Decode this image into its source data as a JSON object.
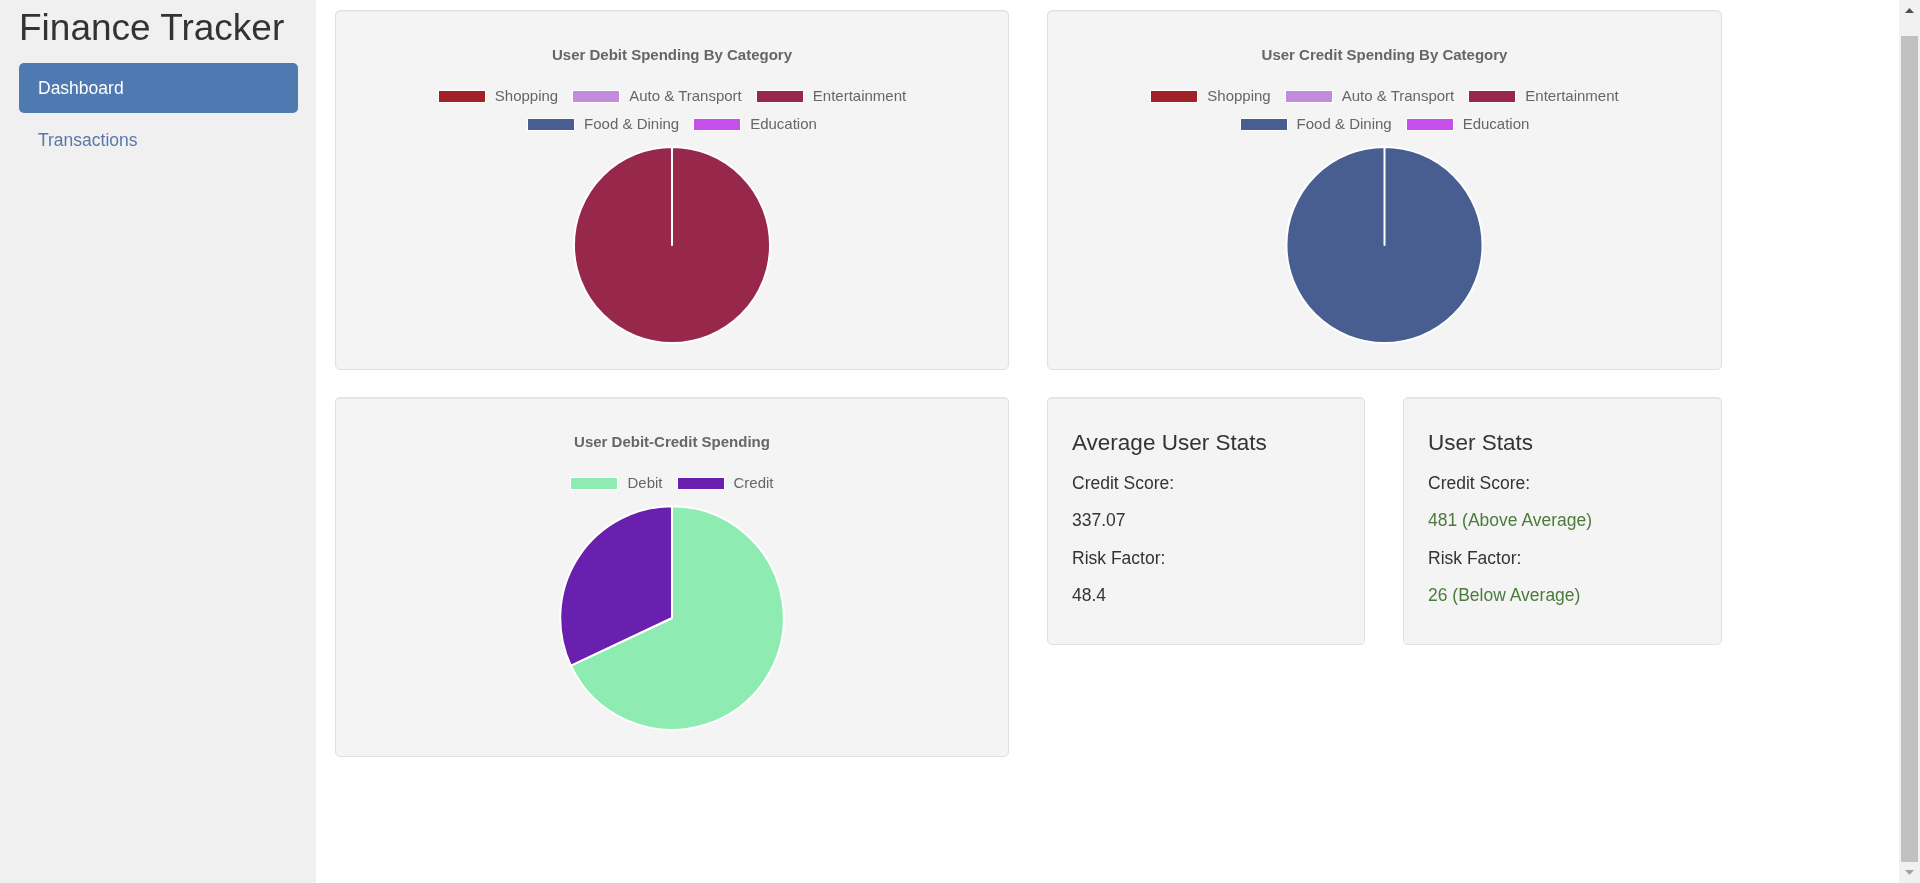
{
  "sidebar": {
    "title": "Finance Tracker",
    "items": [
      {
        "label": "Dashboard",
        "selected": true
      },
      {
        "label": "Transactions",
        "selected": false
      }
    ]
  },
  "charts": [
    {
      "chart_data": {
        "type": "pie",
        "title": "User Debit Spending By Category",
        "legend": "top",
        "categories": [
          "Shopping",
          "Auto & Transport",
          "Entertainment",
          "Food & Dining",
          "Education"
        ],
        "values": [
          0,
          0,
          1,
          0,
          0
        ],
        "colors": [
          "#a02128",
          "#c38bdc",
          "#98284b",
          "#485d90",
          "#c64ee9"
        ]
      }
    },
    {
      "chart_data": {
        "type": "pie",
        "title": "User Credit Spending By Category",
        "legend": "top",
        "categories": [
          "Shopping",
          "Auto & Transport",
          "Entertainment",
          "Food & Dining",
          "Education"
        ],
        "values": [
          0,
          0,
          0,
          1,
          0
        ],
        "colors": [
          "#a02128",
          "#c38bdc",
          "#98284b",
          "#485d90",
          "#c64ee9"
        ]
      }
    },
    {
      "chart_data": {
        "type": "pie",
        "title": "User Debit-Credit Spending",
        "legend": "top",
        "categories": [
          "Debit",
          "Credit"
        ],
        "values": [
          0.68,
          0.32
        ],
        "colors": [
          "#8eecb3",
          "#6a20ae"
        ]
      }
    }
  ],
  "stat_cards": [
    {
      "title": "Average User Stats",
      "fields": [
        {
          "label": "Credit Score:",
          "value": "337.07",
          "success": false
        },
        {
          "label": "Risk Factor:",
          "value": "48.4",
          "success": false
        }
      ]
    },
    {
      "title": "User Stats",
      "fields": [
        {
          "label": "Credit Score:",
          "value": "481 (Above Average)",
          "success": true
        },
        {
          "label": "Risk Factor:",
          "value": "26 (Below Average)",
          "success": true
        }
      ]
    }
  ]
}
